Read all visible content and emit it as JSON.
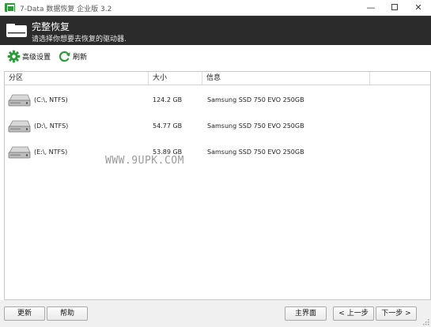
{
  "window": {
    "title": "7-Data 数据恢复 企业版 3.2",
    "minimize_glyph": "—",
    "close_glyph": "✕"
  },
  "header": {
    "title": "完整恢复",
    "subtitle": "请选择你想要去恢复的驱动器."
  },
  "toolbar": {
    "settings_label": "高级设置",
    "refresh_label": "刷新"
  },
  "table": {
    "columns": [
      "分区",
      "大小",
      "信息",
      ""
    ],
    "rows": [
      {
        "partition": "(C:\\, NTFS)",
        "size": "124.2 GB",
        "info": "Samsung SSD 750 EVO 250GB"
      },
      {
        "partition": "(D:\\, NTFS)",
        "size": "54.77 GB",
        "info": "Samsung SSD 750 EVO 250GB"
      },
      {
        "partition": "(E:\\, NTFS)",
        "size": "53.89 GB",
        "info": "Samsung SSD 750 EVO 250GB"
      }
    ]
  },
  "watermark": "WWW.9UPK.COM",
  "footer": {
    "update_label": "更新",
    "help_label": "帮助",
    "main_label": "主界面",
    "prev_label": "< 上一步",
    "next_label": "下一步 >"
  },
  "colors": {
    "header_bg": "#2b2b2b",
    "accent_green": "#2e9a3a",
    "footer_bg": "#f0f0f0"
  }
}
